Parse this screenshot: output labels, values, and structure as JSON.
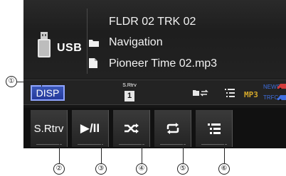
{
  "source": {
    "device_label": "USB",
    "track_line": "FLDR 02 TRK 02",
    "folder_line": "Navigation",
    "file_line": "Pioneer Time 02.mp3"
  },
  "status": {
    "disp_label": "DISP",
    "srtrv_label": "S.Rtrv",
    "srtrv_level": "1",
    "format": "MP3",
    "news_label": "NEWS",
    "trfc_label": "TRFC"
  },
  "softkeys": {
    "srtrv_label": "S.Rtrv",
    "play_pause_label": "▶/II"
  },
  "callouts": [
    "①",
    "②",
    "③",
    "④",
    "⑤",
    "⑥"
  ],
  "colors": {
    "disp_fill": "#2b45a8",
    "mp3": "#d4a82a",
    "news_trfc": "#3f6fe0"
  },
  "icons": {
    "device": "usb-memory-icon",
    "folder": "folder-icon",
    "file": "file-icon",
    "random": "random-play-icon",
    "repeat": "repeat-icon",
    "list": "list-icon"
  }
}
